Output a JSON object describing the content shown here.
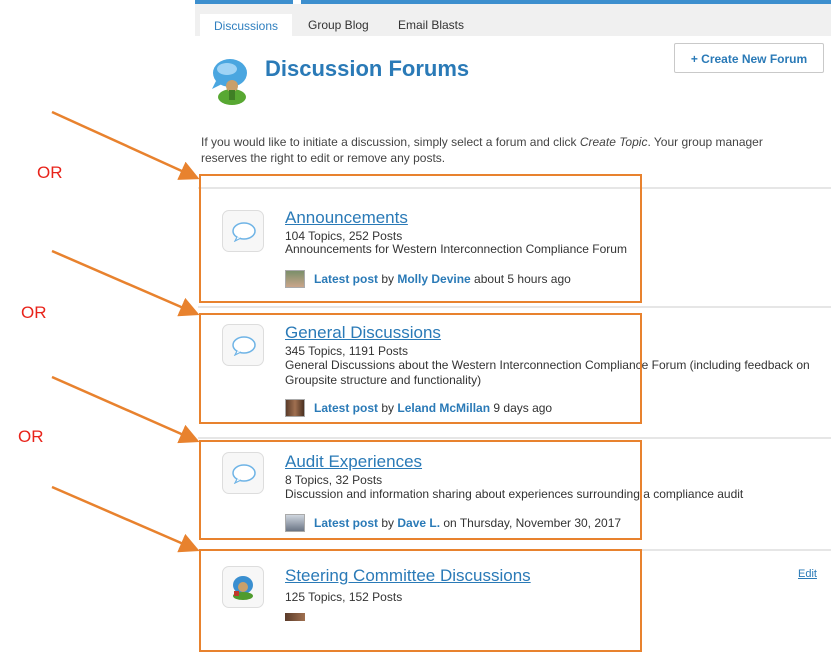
{
  "tabs": [
    {
      "label": "Discussions",
      "active": true
    },
    {
      "label": "Group Blog",
      "active": false
    },
    {
      "label": "Email Blasts",
      "active": false
    }
  ],
  "header": {
    "title": "Discussion Forums",
    "create_button": "+  Create New Forum"
  },
  "intro": {
    "before": "If you would like to initiate a discussion, simply select a forum and click ",
    "emphasis": "Create Topic",
    "after": ". Your group manager reserves the right to edit or remove any posts."
  },
  "forums": [
    {
      "name": "Announcements",
      "counts": "104 Topics, 252 Posts",
      "description": "Announcements for Western Interconnection Compliance Forum",
      "latest_label": "Latest post",
      "by": " by ",
      "author": "Molly Devine",
      "when": " about 5 hours ago"
    },
    {
      "name": "General Discussions",
      "counts": "345 Topics, 1191 Posts",
      "description": "General Discussions about the Western Interconnection Compliance Forum (including feedback on Groupsite structure and functionality)",
      "latest_label": "Latest post",
      "by": " by ",
      "author": "Leland McMillan",
      "when": " 9 days ago"
    },
    {
      "name": "Audit Experiences",
      "counts": "8 Topics, 32 Posts",
      "description": "Discussion and information sharing about experiences surrounding a compliance audit",
      "latest_label": "Latest post",
      "by": " by ",
      "author": "Dave L.",
      "when": " on Thursday, November 30, 2017"
    },
    {
      "name": "Steering Committee Discussions",
      "counts": "125 Topics, 152 Posts",
      "edit_label": "Edit"
    }
  ],
  "annotations": {
    "or_labels": [
      "OR",
      "OR",
      "OR"
    ],
    "color": "#e8822e",
    "or_color": "#e8231a"
  },
  "colors": {
    "link": "#2a7ab7",
    "tab_stripe": "#3d8fce"
  }
}
